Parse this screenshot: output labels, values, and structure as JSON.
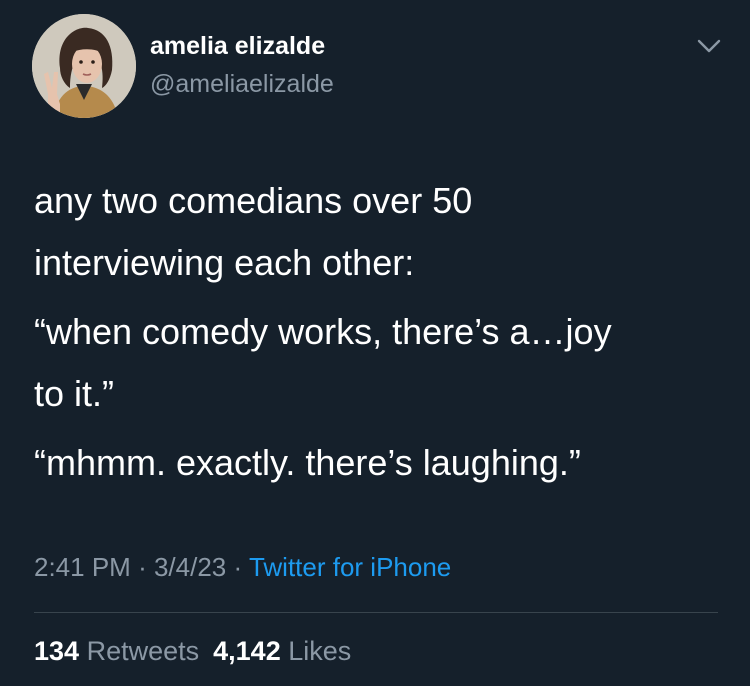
{
  "user": {
    "display_name": "amelia elizalde",
    "handle": "@ameliaelizalde"
  },
  "tweet": {
    "paragraphs": [
      [
        "any two comedians over 50",
        "interviewing each other:"
      ],
      [
        "“when comedy works, there’s a…joy",
        "to it.”"
      ],
      [
        "“mhmm. exactly. there’s laughing.”"
      ]
    ]
  },
  "meta": {
    "time": "2:41 PM",
    "separator": "·",
    "date": "3/4/23",
    "source": "Twitter for iPhone"
  },
  "stats": {
    "retweets_count": "134",
    "retweets_label": "Retweets",
    "likes_count": "4,142",
    "likes_label": "Likes"
  },
  "icons": {
    "more": "chevron-down-icon",
    "avatar": "avatar"
  },
  "colors": {
    "background": "#15202b",
    "primary_text": "#ffffff",
    "secondary_text": "#8b98a5",
    "link": "#1d9bf0",
    "divider": "#38444d"
  }
}
